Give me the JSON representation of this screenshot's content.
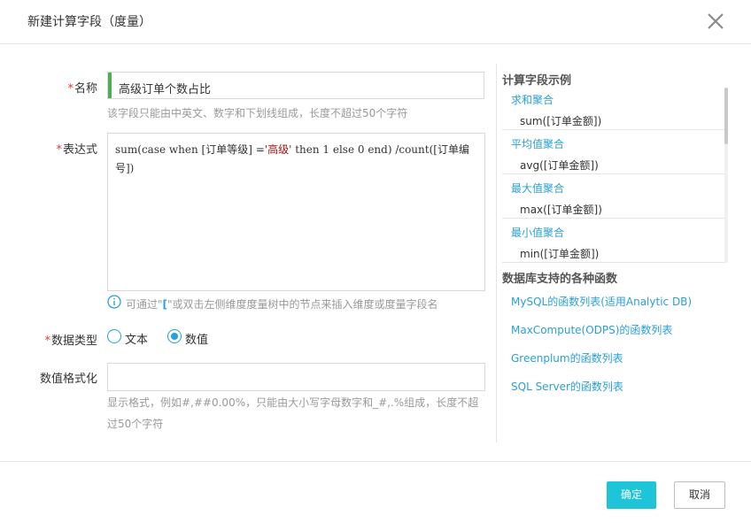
{
  "dialog": {
    "title": "新建计算字段（度量）"
  },
  "form": {
    "name_required": "*",
    "name_label": "名称",
    "name_value": "高级订单个数占比",
    "name_hint": "该字段只能由中英文、数字和下划线组成，长度不超过50个字符",
    "expr_required": "*",
    "expr_label": "表达式",
    "expr_parts": {
      "p1": "sum(case when [订单等级] =",
      "p2": "'高级'",
      "p3": " then 1 else 0 end) /count([订单编号])"
    },
    "info_pre": "可通过\"",
    "info_bracket": "[",
    "info_post": "\"或双击左侧维度度量树中的节点来插入维度或度量字段名",
    "type_required": "*",
    "type_label": "数据类型",
    "type_option_text": "文本",
    "type_option_number": "数值",
    "type_selected": "数值",
    "format_label": "数值格式化",
    "format_value": "",
    "format_hint_line1": "显示格式，例如#,##0.00%，只能由大小写字母数字和_#,.%组成，长度不超",
    "format_hint_line2": "过50个字符"
  },
  "sidebar": {
    "examples_title": "计算字段示例",
    "examples": [
      {
        "name": "求和聚合",
        "code": "sum([订单金额])"
      },
      {
        "name": "平均值聚合",
        "code": "avg([订单金额])"
      },
      {
        "name": "最大值聚合",
        "code": "max([订单金额])"
      },
      {
        "name": "最小值聚合",
        "code": "min([订单金额])"
      }
    ],
    "functions_title": "数据库支持的各种函数",
    "function_links": [
      "MySQL的函数列表(适用Analytic DB)",
      "MaxCompute(ODPS)的函数列表",
      "Greenplum的函数列表",
      "SQL Server的函数列表"
    ]
  },
  "footer": {
    "ok_label": "确定",
    "cancel_label": "取消"
  },
  "colors": {
    "accent": "#2a9fd8",
    "primary_button": "#1ec4d8",
    "required": "#e53935",
    "name_bar": "#4caf50"
  }
}
